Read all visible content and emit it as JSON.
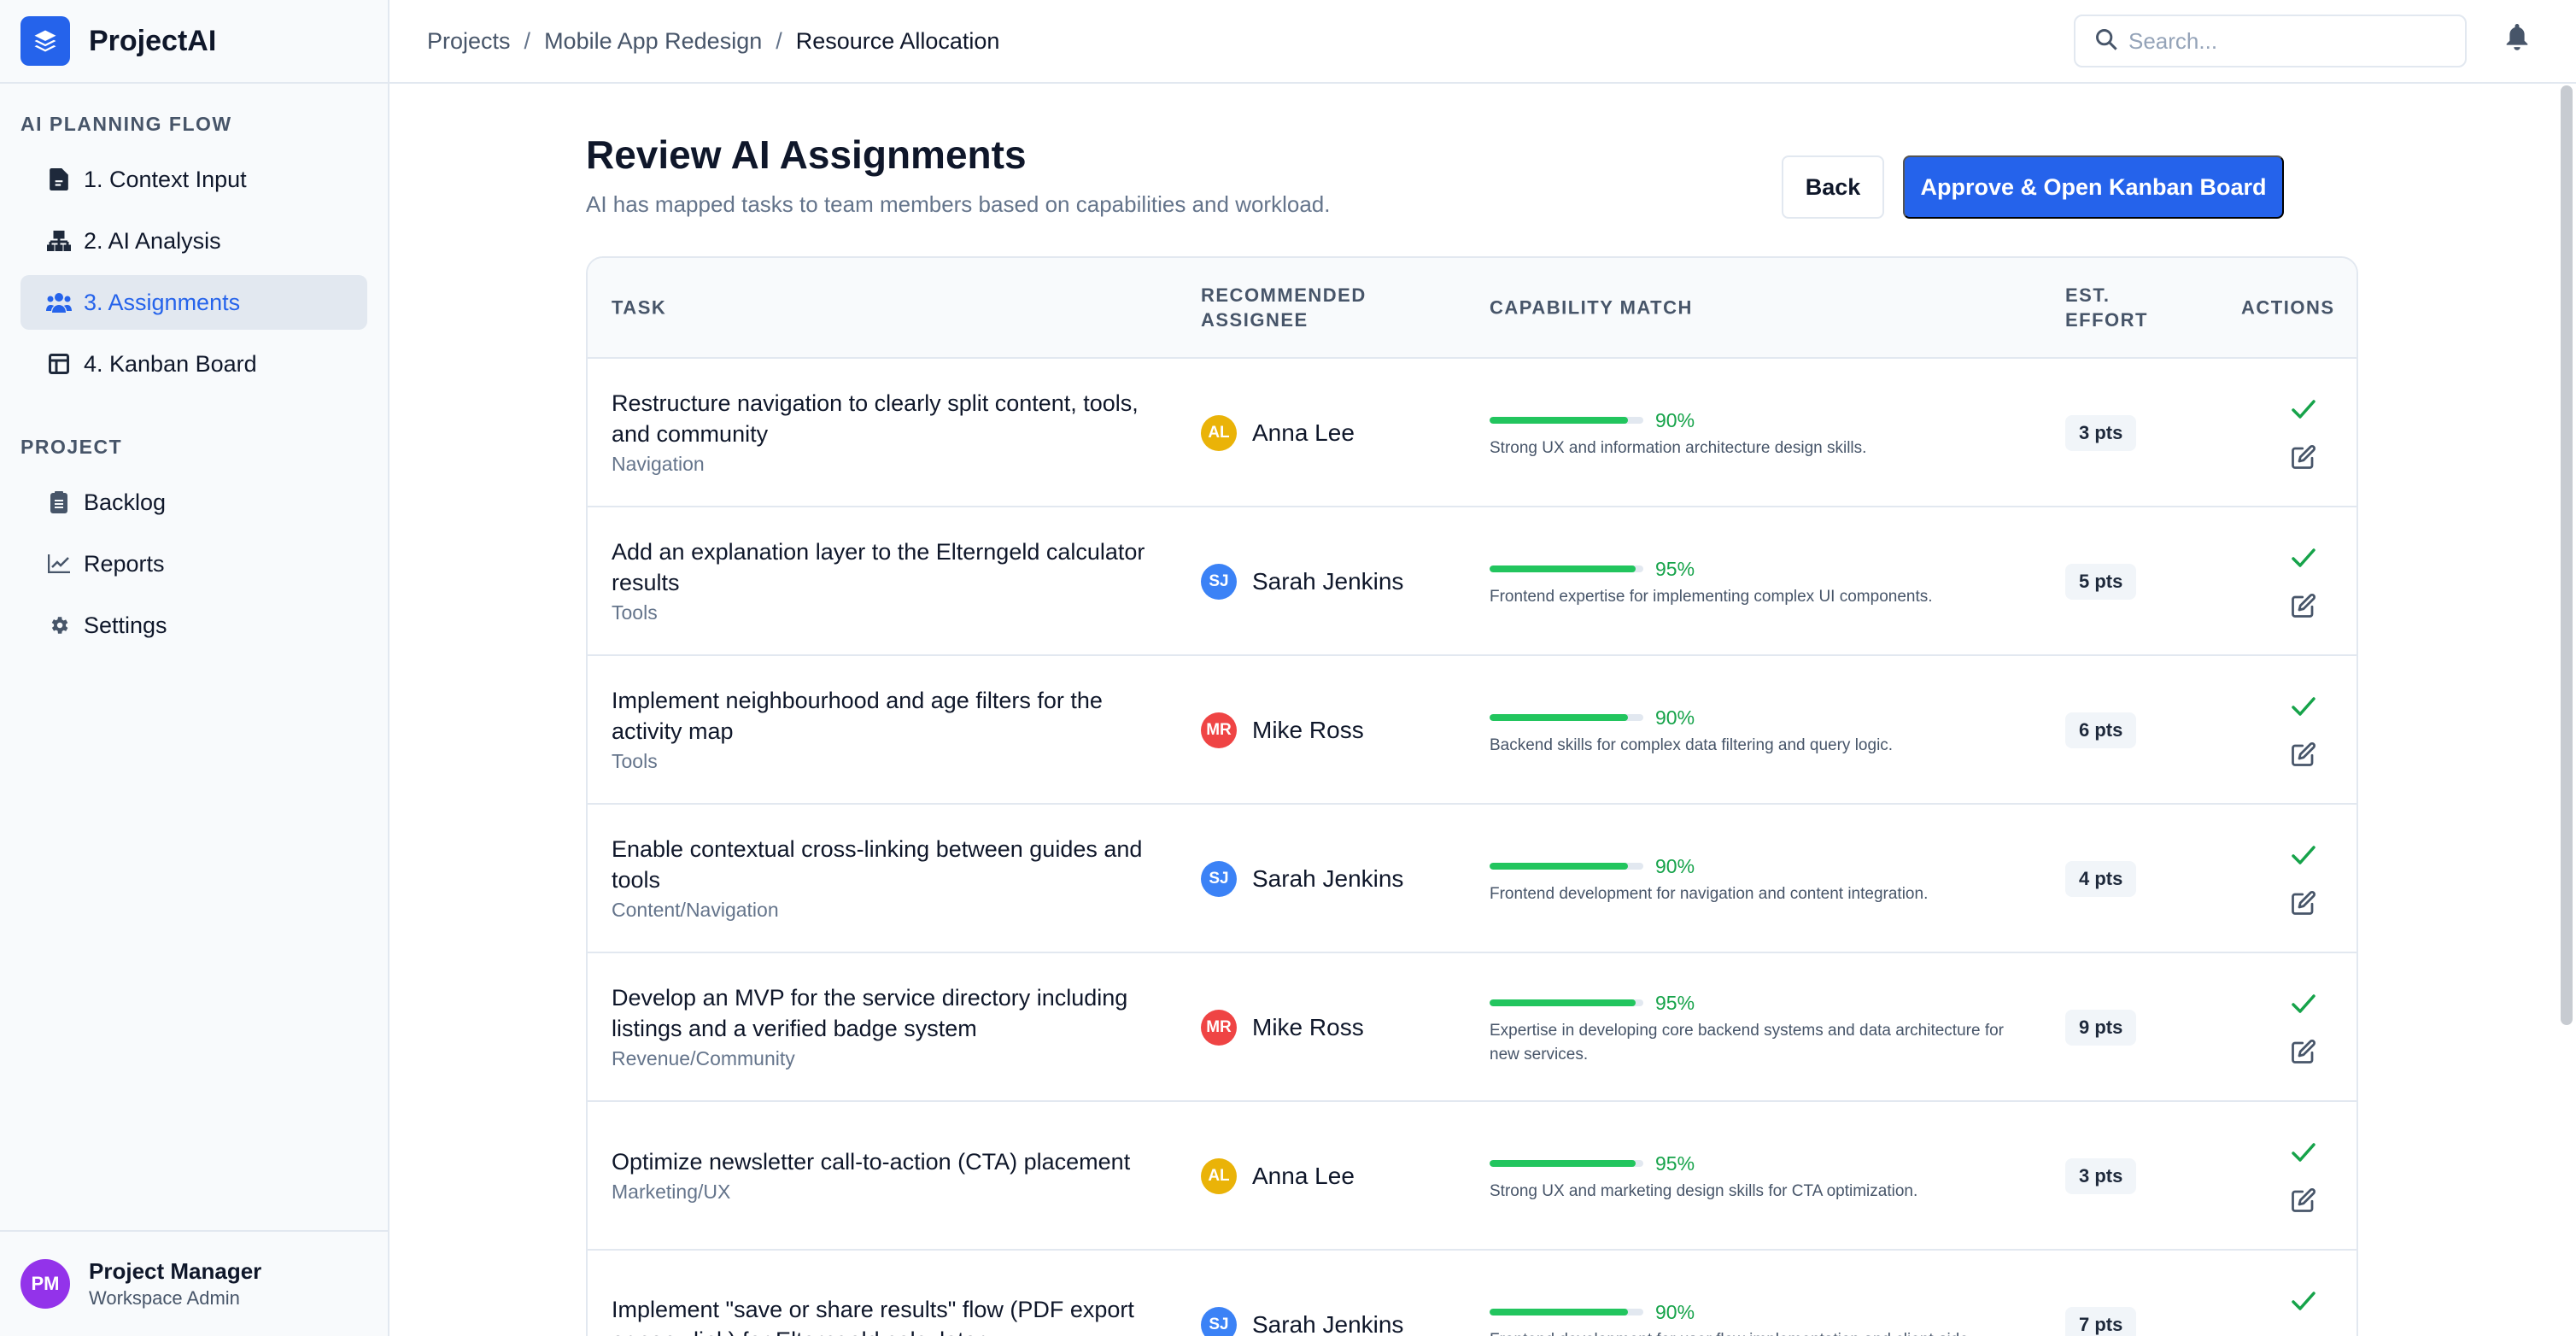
{
  "app": {
    "name": "ProjectAI"
  },
  "sidebar": {
    "flow_heading": "AI PLANNING FLOW",
    "flow_items": [
      {
        "label": "1. Context Input",
        "icon": "document-icon"
      },
      {
        "label": "2. AI Analysis",
        "icon": "hierarchy-icon"
      },
      {
        "label": "3. Assignments",
        "icon": "users-icon",
        "active": true
      },
      {
        "label": "4. Kanban Board",
        "icon": "columns-icon"
      }
    ],
    "project_heading": "PROJECT",
    "project_items": [
      {
        "label": "Backlog",
        "icon": "clipboard-icon"
      },
      {
        "label": "Reports",
        "icon": "chart-line-icon"
      },
      {
        "label": "Settings",
        "icon": "gear-icon"
      }
    ],
    "user": {
      "initials": "PM",
      "name": "Project Manager",
      "role": "Workspace Admin"
    }
  },
  "topbar": {
    "breadcrumbs": [
      "Projects",
      "Mobile App Redesign",
      "Resource Allocation"
    ],
    "separator": "/",
    "search_placeholder": "Search..."
  },
  "page": {
    "title": "Review AI Assignments",
    "subtitle": "AI has mapped tasks to team members based on capabilities and workload.",
    "back_label": "Back",
    "approve_label": "Approve & Open Kanban Board"
  },
  "table": {
    "headers": {
      "task": "TASK",
      "assignee_line1": "RECOMMENDED",
      "assignee_line2": "ASSIGNEE",
      "match": "CAPABILITY MATCH",
      "effort_line1": "EST.",
      "effort_line2": "EFFORT",
      "actions": "ACTIONS"
    },
    "rows": [
      {
        "title": "Restructure navigation to clearly split content, tools, and community",
        "category": "Navigation",
        "initials": "AL",
        "assignee": "Anna Lee",
        "avatar_color": "#eab308",
        "match": 90,
        "match_label": "90%",
        "desc": "Strong UX and information architecture design skills.",
        "effort": "3 pts"
      },
      {
        "title": "Add an explanation layer to the Elterngeld calculator results",
        "category": "Tools",
        "initials": "SJ",
        "assignee": "Sarah Jenkins",
        "avatar_color": "#3b82f6",
        "match": 95,
        "match_label": "95%",
        "desc": "Frontend expertise for implementing complex UI components.",
        "effort": "5 pts"
      },
      {
        "title": "Implement neighbourhood and age filters for the activity map",
        "category": "Tools",
        "initials": "MR",
        "assignee": "Mike Ross",
        "avatar_color": "#ef4444",
        "match": 90,
        "match_label": "90%",
        "desc": "Backend skills for complex data filtering and query logic.",
        "effort": "6 pts"
      },
      {
        "title": "Enable contextual cross-linking between guides and tools",
        "category": "Content/Navigation",
        "initials": "SJ",
        "assignee": "Sarah Jenkins",
        "avatar_color": "#3b82f6",
        "match": 90,
        "match_label": "90%",
        "desc": "Frontend development for navigation and content integration.",
        "effort": "4 pts"
      },
      {
        "title": "Develop an MVP for the service directory including listings and a verified badge system",
        "category": "Revenue/Community",
        "initials": "MR",
        "assignee": "Mike Ross",
        "avatar_color": "#ef4444",
        "match": 95,
        "match_label": "95%",
        "desc": "Expertise in developing core backend systems and data architecture for new services.",
        "effort": "9 pts"
      },
      {
        "title": "Optimize newsletter call-to-action (CTA) placement",
        "category": "Marketing/UX",
        "initials": "AL",
        "assignee": "Anna Lee",
        "avatar_color": "#eab308",
        "match": 95,
        "match_label": "95%",
        "desc": "Strong UX and marketing design skills for CTA optimization.",
        "effort": "3 pts"
      },
      {
        "title": "Implement \"save or share results\" flow (PDF export or copy link) for Elterngeld calculator",
        "category": "",
        "initials": "SJ",
        "assignee": "Sarah Jenkins",
        "avatar_color": "#3b82f6",
        "match": 90,
        "match_label": "90%",
        "desc": "Frontend development for user flow implementation and client-side",
        "effort": "7 pts"
      }
    ]
  },
  "colors": {
    "accent": "#2563eb",
    "success": "#16a34a",
    "bar": "#22c55e"
  }
}
